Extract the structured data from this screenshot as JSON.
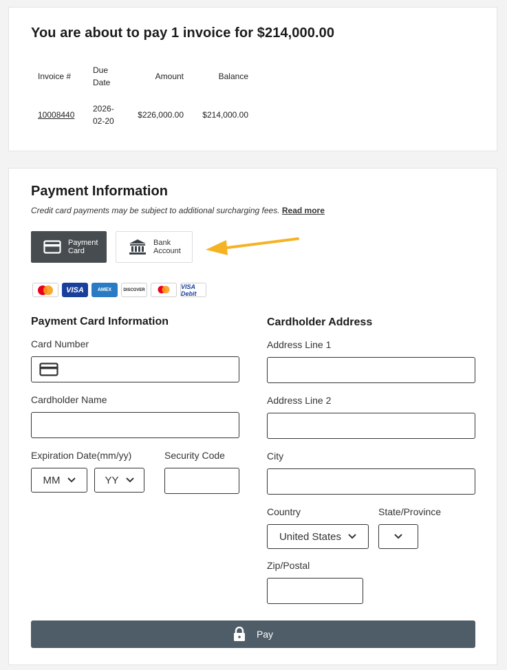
{
  "summary": {
    "title": "You are about to pay 1 invoice for $214,000.00",
    "columns": [
      "Invoice #",
      "Due Date",
      "Amount",
      "Balance"
    ],
    "rows": [
      {
        "invoice": "10008440",
        "due": "2026-02-20",
        "amount": "$226,000.00",
        "balance": "$214,000.00"
      }
    ]
  },
  "payment": {
    "title": "Payment Information",
    "note": "Credit card payments may be subject to additional surcharging fees.",
    "read_more": "Read more",
    "tabs": [
      {
        "label": "Payment Card",
        "selected": true
      },
      {
        "label": "Bank Account",
        "selected": false
      }
    ],
    "card_brands": [
      "Mastercard",
      "VISA",
      "AMEX",
      "DISCOVER",
      "Maestro",
      "VISA Debit"
    ]
  },
  "card_info": {
    "title": "Payment Card Information",
    "card_number_label": "Card Number",
    "cardholder_name_label": "Cardholder Name",
    "expiration_label": "Expiration Date(mm/yy)",
    "month_value": "MM",
    "year_value": "YY",
    "security_code_label": "Security Code"
  },
  "address": {
    "title": "Cardholder Address",
    "line1_label": "Address Line 1",
    "line2_label": "Address Line 2",
    "city_label": "City",
    "country_label": "Country",
    "country_value": "United States",
    "state_label": "State/Province",
    "zip_label": "Zip/Postal"
  },
  "pay_button": "Pay",
  "colors": {
    "primary_button": "#4e5d67",
    "selected_tab": "#474c50",
    "arrow": "#f5b324"
  }
}
